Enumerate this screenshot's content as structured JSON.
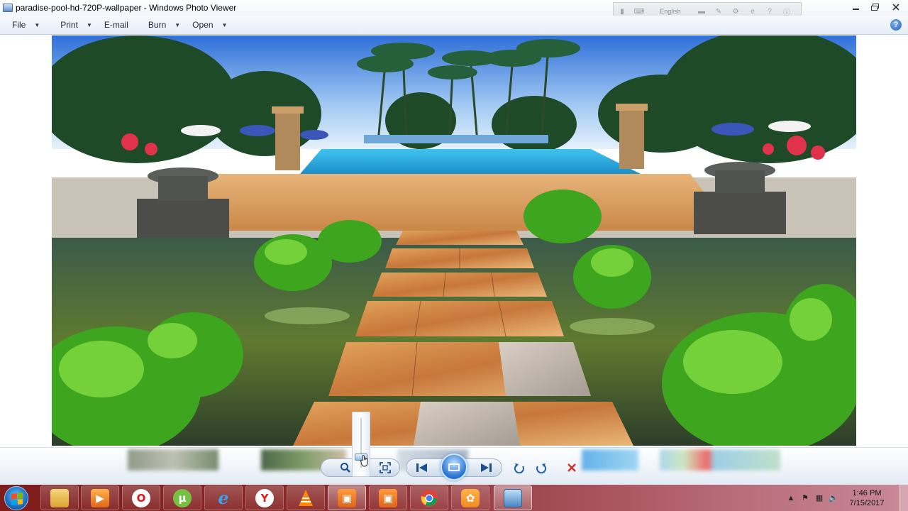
{
  "window": {
    "title": "paradise-pool-hd-720P-wallpaper - Windows Photo Viewer",
    "controls": {
      "minimize_icon": "minimize-icon",
      "maximize_icon": "restore-icon",
      "close_icon": "close-icon"
    }
  },
  "language_bar": {
    "label": "English"
  },
  "menu": {
    "items": [
      {
        "label": "File"
      },
      {
        "label": "Print"
      },
      {
        "label": "E-mail"
      },
      {
        "label": "Burn"
      },
      {
        "label": "Open"
      }
    ],
    "help_label": "?"
  },
  "photo": {
    "description_icon": "photo-image"
  },
  "controls": {
    "zoom_icon": "magnifier-icon",
    "actual_size_icon": "fit-window-icon",
    "previous_icon": "previous-icon",
    "slideshow_icon": "slideshow-icon",
    "next_icon": "next-icon",
    "rotate_ccw_icon": "rotate-counterclockwise-icon",
    "rotate_cw_icon": "rotate-clockwise-icon",
    "delete_icon": "delete-icon",
    "delete_color": "#d0302a",
    "zoom_level_fraction": 0.14
  },
  "taskbar": {
    "pinned": [
      {
        "name": "file-explorer",
        "label": ""
      },
      {
        "name": "media-player",
        "label": ""
      },
      {
        "name": "opera",
        "label": "O"
      },
      {
        "name": "utorrent",
        "label": "µ"
      },
      {
        "name": "internet-explorer",
        "label": "e"
      },
      {
        "name": "yandex",
        "label": "Y"
      },
      {
        "name": "vlc",
        "label": ""
      },
      {
        "name": "app-orange-1",
        "label": ""
      },
      {
        "name": "app-orange-2",
        "label": ""
      },
      {
        "name": "chrome",
        "label": ""
      },
      {
        "name": "uc-browser",
        "label": ""
      },
      {
        "name": "photo-viewer",
        "label": ""
      }
    ],
    "clock": {
      "time": "1:46 PM",
      "date": "7/15/2017"
    }
  },
  "colors": {
    "taskbar_start": "#7e1d1c",
    "taskbar_end": "#c98a98",
    "menu_bg": "#e6edf6",
    "accent_blue": "#2d78d6"
  }
}
